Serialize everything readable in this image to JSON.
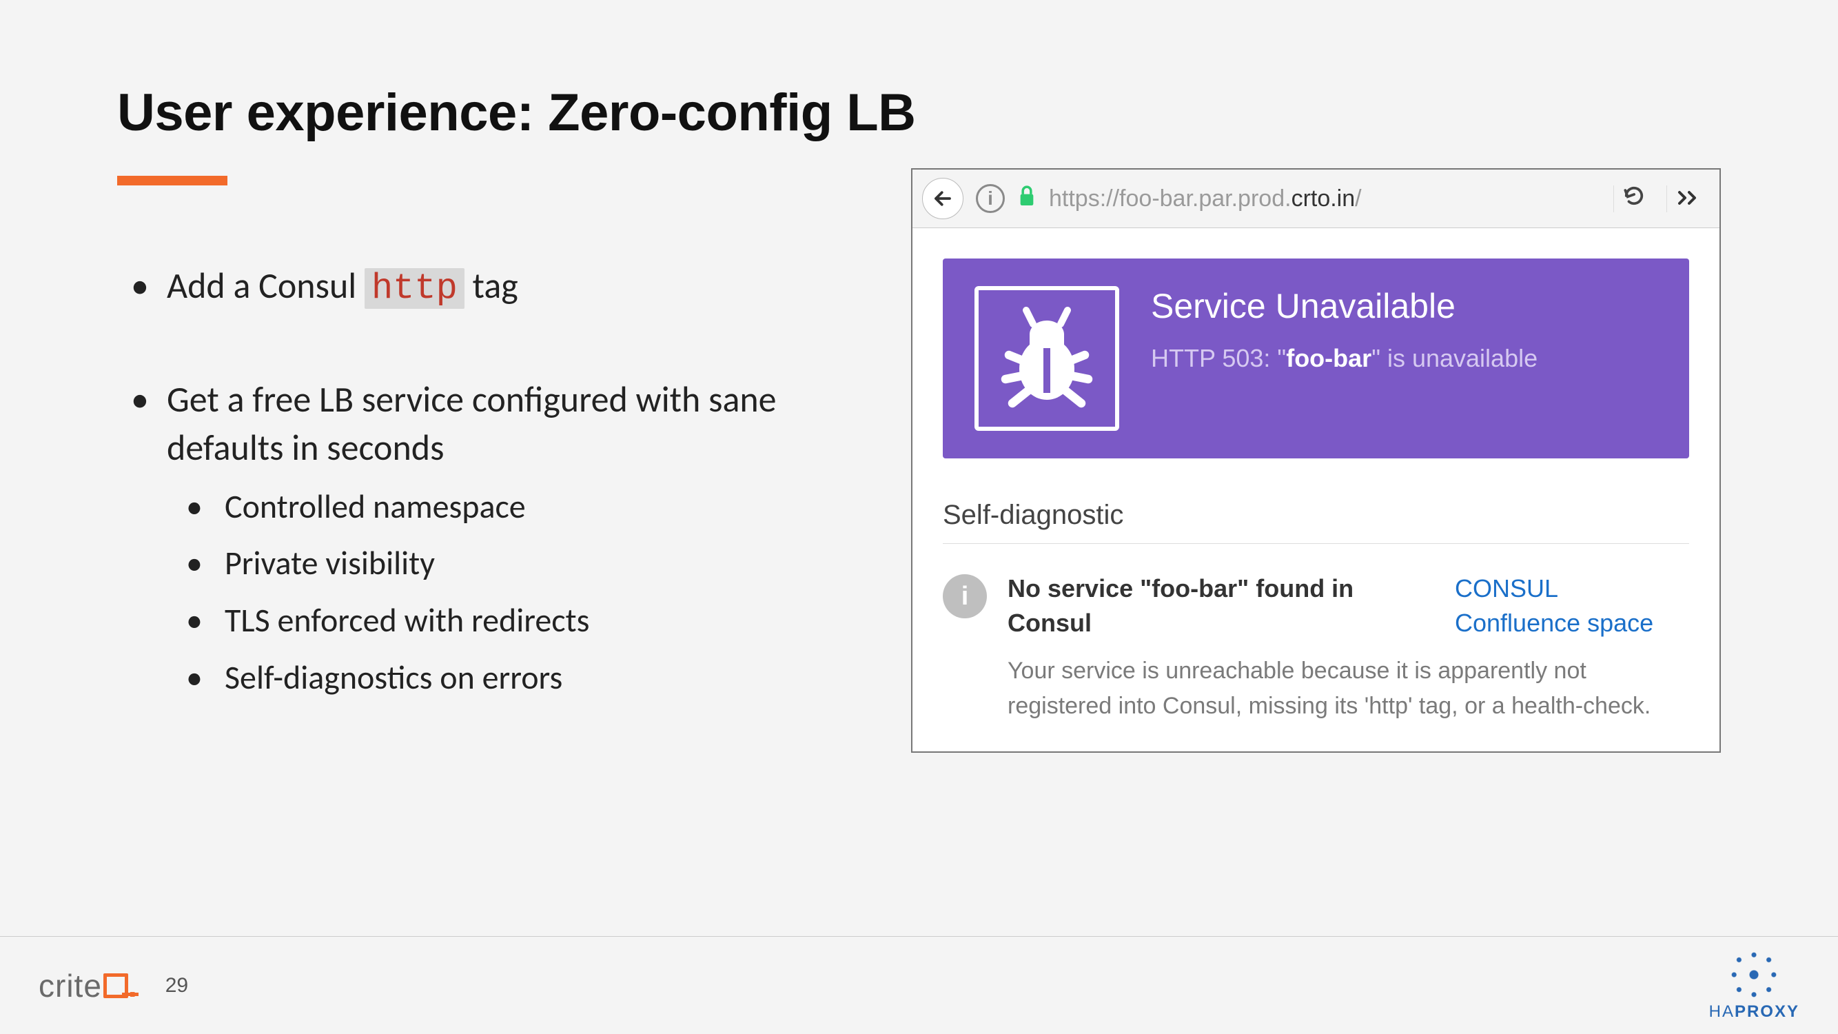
{
  "slide": {
    "title": "User experience: Zero-config LB",
    "page_number": "29"
  },
  "bullets": [
    {
      "prefix": "Add a Consul ",
      "code": "http",
      "suffix": " tag"
    },
    {
      "text": "Get a free LB service configured with sane defaults in seconds",
      "sub": [
        "Controlled namespace",
        "Private visibility",
        "TLS enforced with redirects",
        "Self-diagnostics on errors"
      ]
    }
  ],
  "browser": {
    "url_grey_prefix": "https://foo-bar.par.prod.",
    "url_dark": "crto.in",
    "url_grey_suffix": "/",
    "banner": {
      "title": "Service Unavailable",
      "sub_prefix": "HTTP 503: \"",
      "sub_bold": "foo-bar",
      "sub_suffix": "\" is unavailable"
    },
    "diag": {
      "section": "Self-diagnostic",
      "headline": "No service \"foo-bar\" found in Consul",
      "link": "CONSUL Confluence space",
      "desc": "Your service is unreachable because it is apparently not registered into Consul, missing its 'http' tag, or a health-check."
    }
  },
  "footer": {
    "criteo": "crite",
    "haproxy_a": "HA",
    "haproxy_b": "PROXY"
  }
}
